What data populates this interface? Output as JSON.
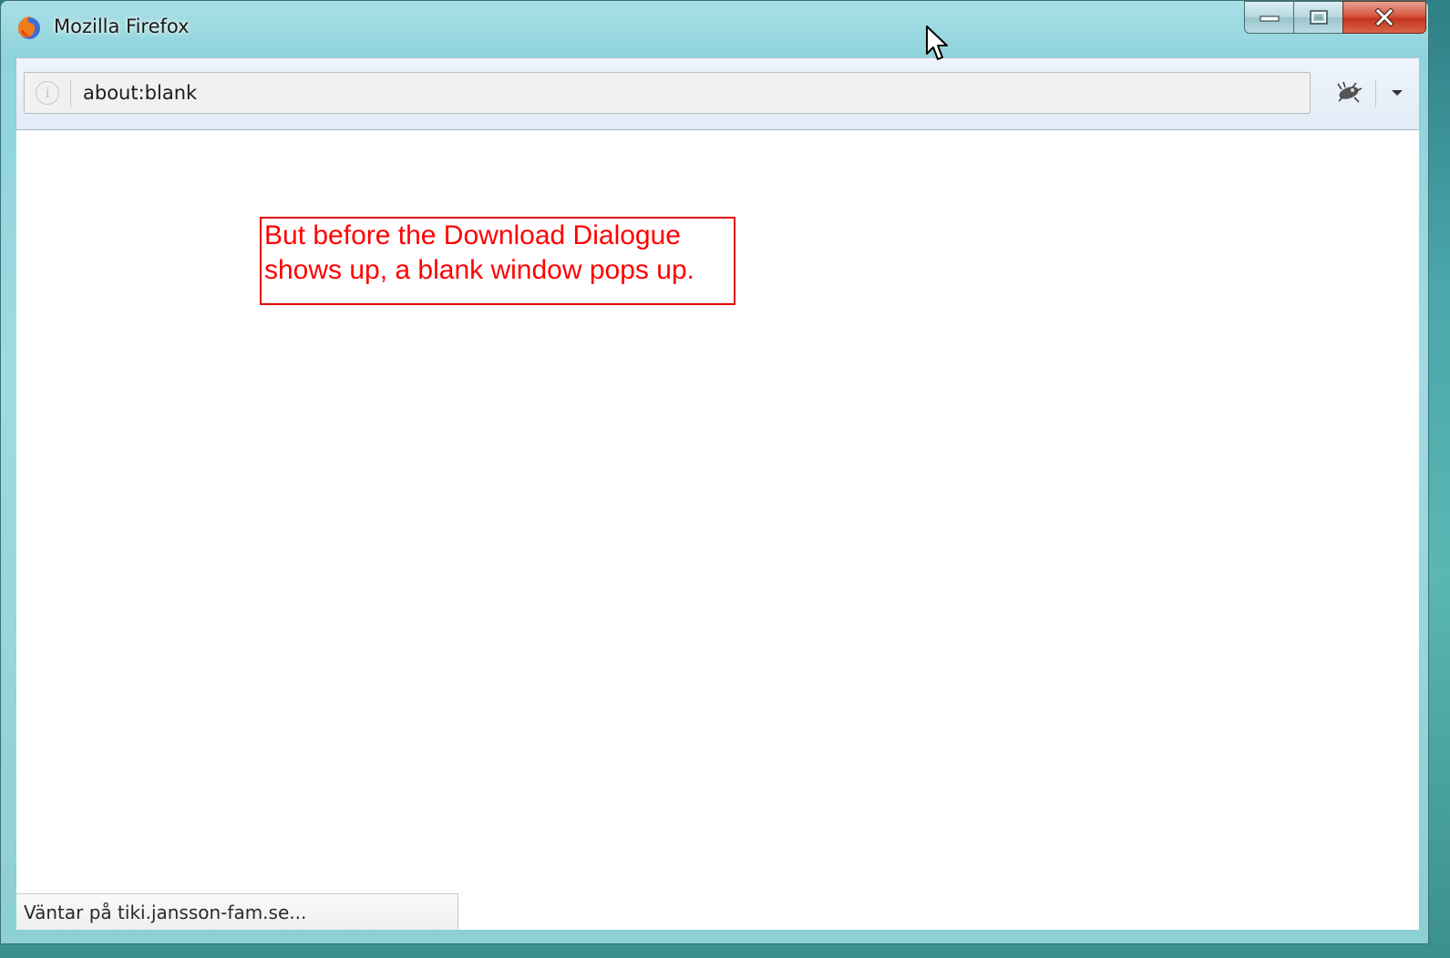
{
  "window": {
    "title": "Mozilla Firefox",
    "app_icon": "firefox-icon",
    "caption_buttons": [
      "minimize-icon",
      "maximize-icon",
      "close-icon"
    ]
  },
  "toolbar": {
    "url": "about:blank",
    "info_icon": "info-icon",
    "extension_icon": "extension-icon",
    "menu_icon": "dropdown-arrow-icon"
  },
  "content": {
    "annotation": {
      "line1": "But before the Download Dialogue",
      "line2": "shows up, a blank window pops up.",
      "color": "#ff0000"
    }
  },
  "statusbar": {
    "text": "Väntar på tiki.jansson-fam.se..."
  }
}
